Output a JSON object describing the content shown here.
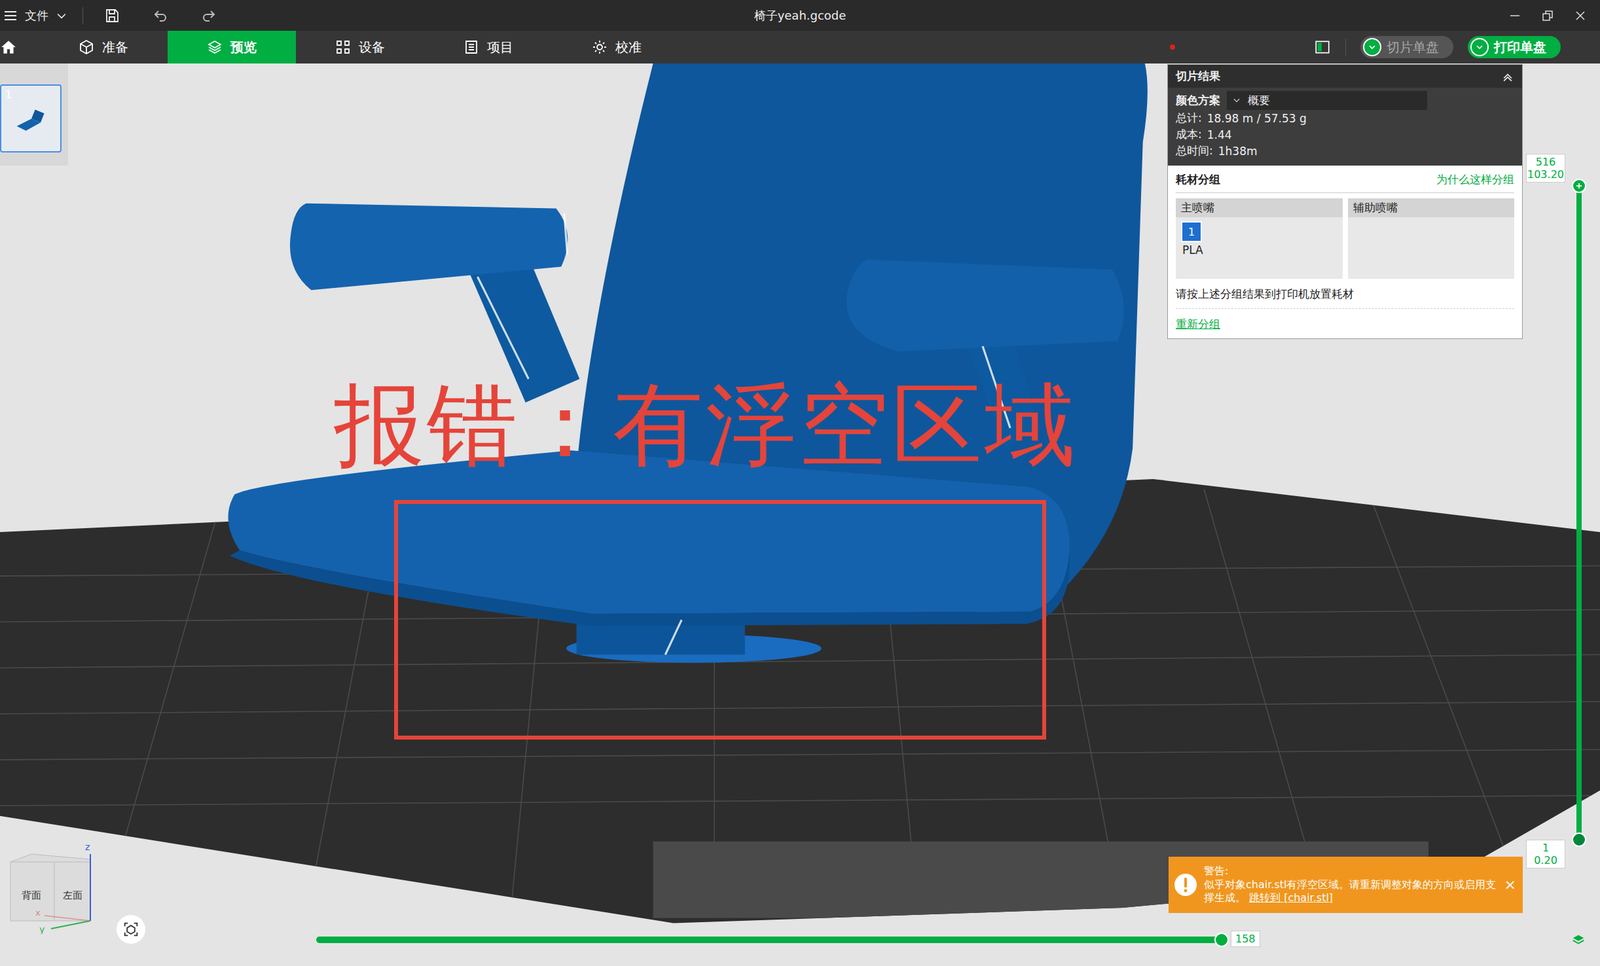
{
  "window": {
    "menu": "文件",
    "title": "椅子yeah.gcode"
  },
  "tabs": [
    {
      "label": "准备",
      "selected": false
    },
    {
      "label": "预览",
      "selected": true
    },
    {
      "label": "设备",
      "selected": false
    },
    {
      "label": "项目",
      "selected": false
    },
    {
      "label": "校准",
      "selected": false
    }
  ],
  "buttons": [
    {
      "label": "切片单盘",
      "disabled": true
    },
    {
      "label": "打印单盘",
      "disabled": false
    }
  ],
  "plates": [
    {
      "label": "1",
      "selected": true
    }
  ],
  "annotation": {
    "text": "报错：有浮空区域"
  },
  "slice_result": {
    "title": "切片结果",
    "color_scheme_label": "颜色方案",
    "color_scheme_value": "概要",
    "stats": [
      {
        "label": "总计:",
        "value": "18.98 m / 57.53 g"
      },
      {
        "label": "成本:",
        "value": "1.44"
      },
      {
        "label": "总时间:",
        "value": "1h38m"
      }
    ],
    "grouping": {
      "title": "耗材分组",
      "why_link": "为什么这样分组",
      "nozzles": [
        {
          "label": "主喷嘴",
          "filaments": [
            {
              "index": "1",
              "name": "PLA",
              "color": "#1e6fd0"
            }
          ]
        },
        {
          "label": "辅助喷嘴",
          "filaments": []
        }
      ],
      "hint": "请按上述分组结果到打印机放置耗材",
      "regroup_link": "重新分组"
    }
  },
  "layer_slider": {
    "top_layer": "516",
    "top_height": "103.20",
    "bottom_layer": "1",
    "bottom_height": "0.20",
    "level": 1
  },
  "move_slider": {
    "value": "158",
    "level": 1
  },
  "warning": {
    "title": "警告:",
    "message": "似乎对象chair.stl有浮空区域。请重新调整对象的方向或启用支撑生成。",
    "link": "跳转到 [chair.stl]",
    "close": "×"
  },
  "view_cube": {
    "faces": [
      "背面",
      "左面"
    ],
    "axes": [
      "z",
      "y",
      "x"
    ]
  }
}
